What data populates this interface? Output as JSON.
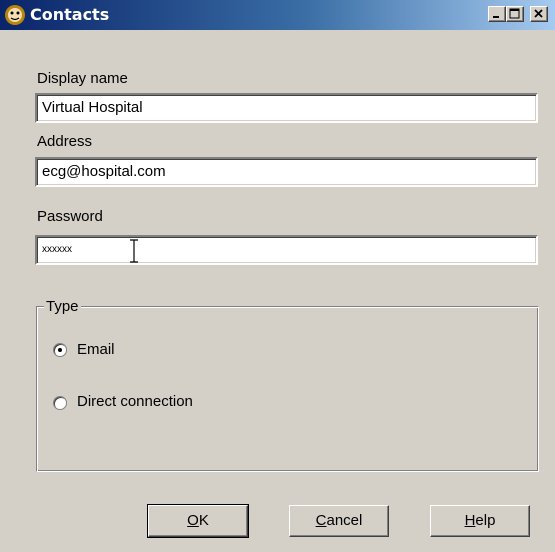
{
  "window": {
    "title": "Contacts",
    "icon": "contacts-app-icon"
  },
  "titlebar_buttons": {
    "minimize_icon": "minimize-icon",
    "maximize_icon": "maximize-icon",
    "close_icon": "close-icon"
  },
  "form": {
    "display_name_label": "Display name",
    "display_name_value": "Virtual Hospital",
    "address_label": "Address",
    "address_value": "ecg@hospital.com",
    "password_label": "Password",
    "password_value": "xxxxxx"
  },
  "type_group": {
    "legend": "Type",
    "options": [
      {
        "label": "Email",
        "selected": true
      },
      {
        "label": "Direct connection",
        "selected": false
      }
    ]
  },
  "buttons": {
    "ok_accel": "O",
    "ok_rest": "K",
    "cancel_accel": "C",
    "cancel_rest": "ancel",
    "help_accel": "H",
    "help_rest": "elp"
  },
  "colors": {
    "titlebar_start": "#0a246a",
    "titlebar_end": "#a6caf0",
    "face": "#d4d0c8"
  }
}
